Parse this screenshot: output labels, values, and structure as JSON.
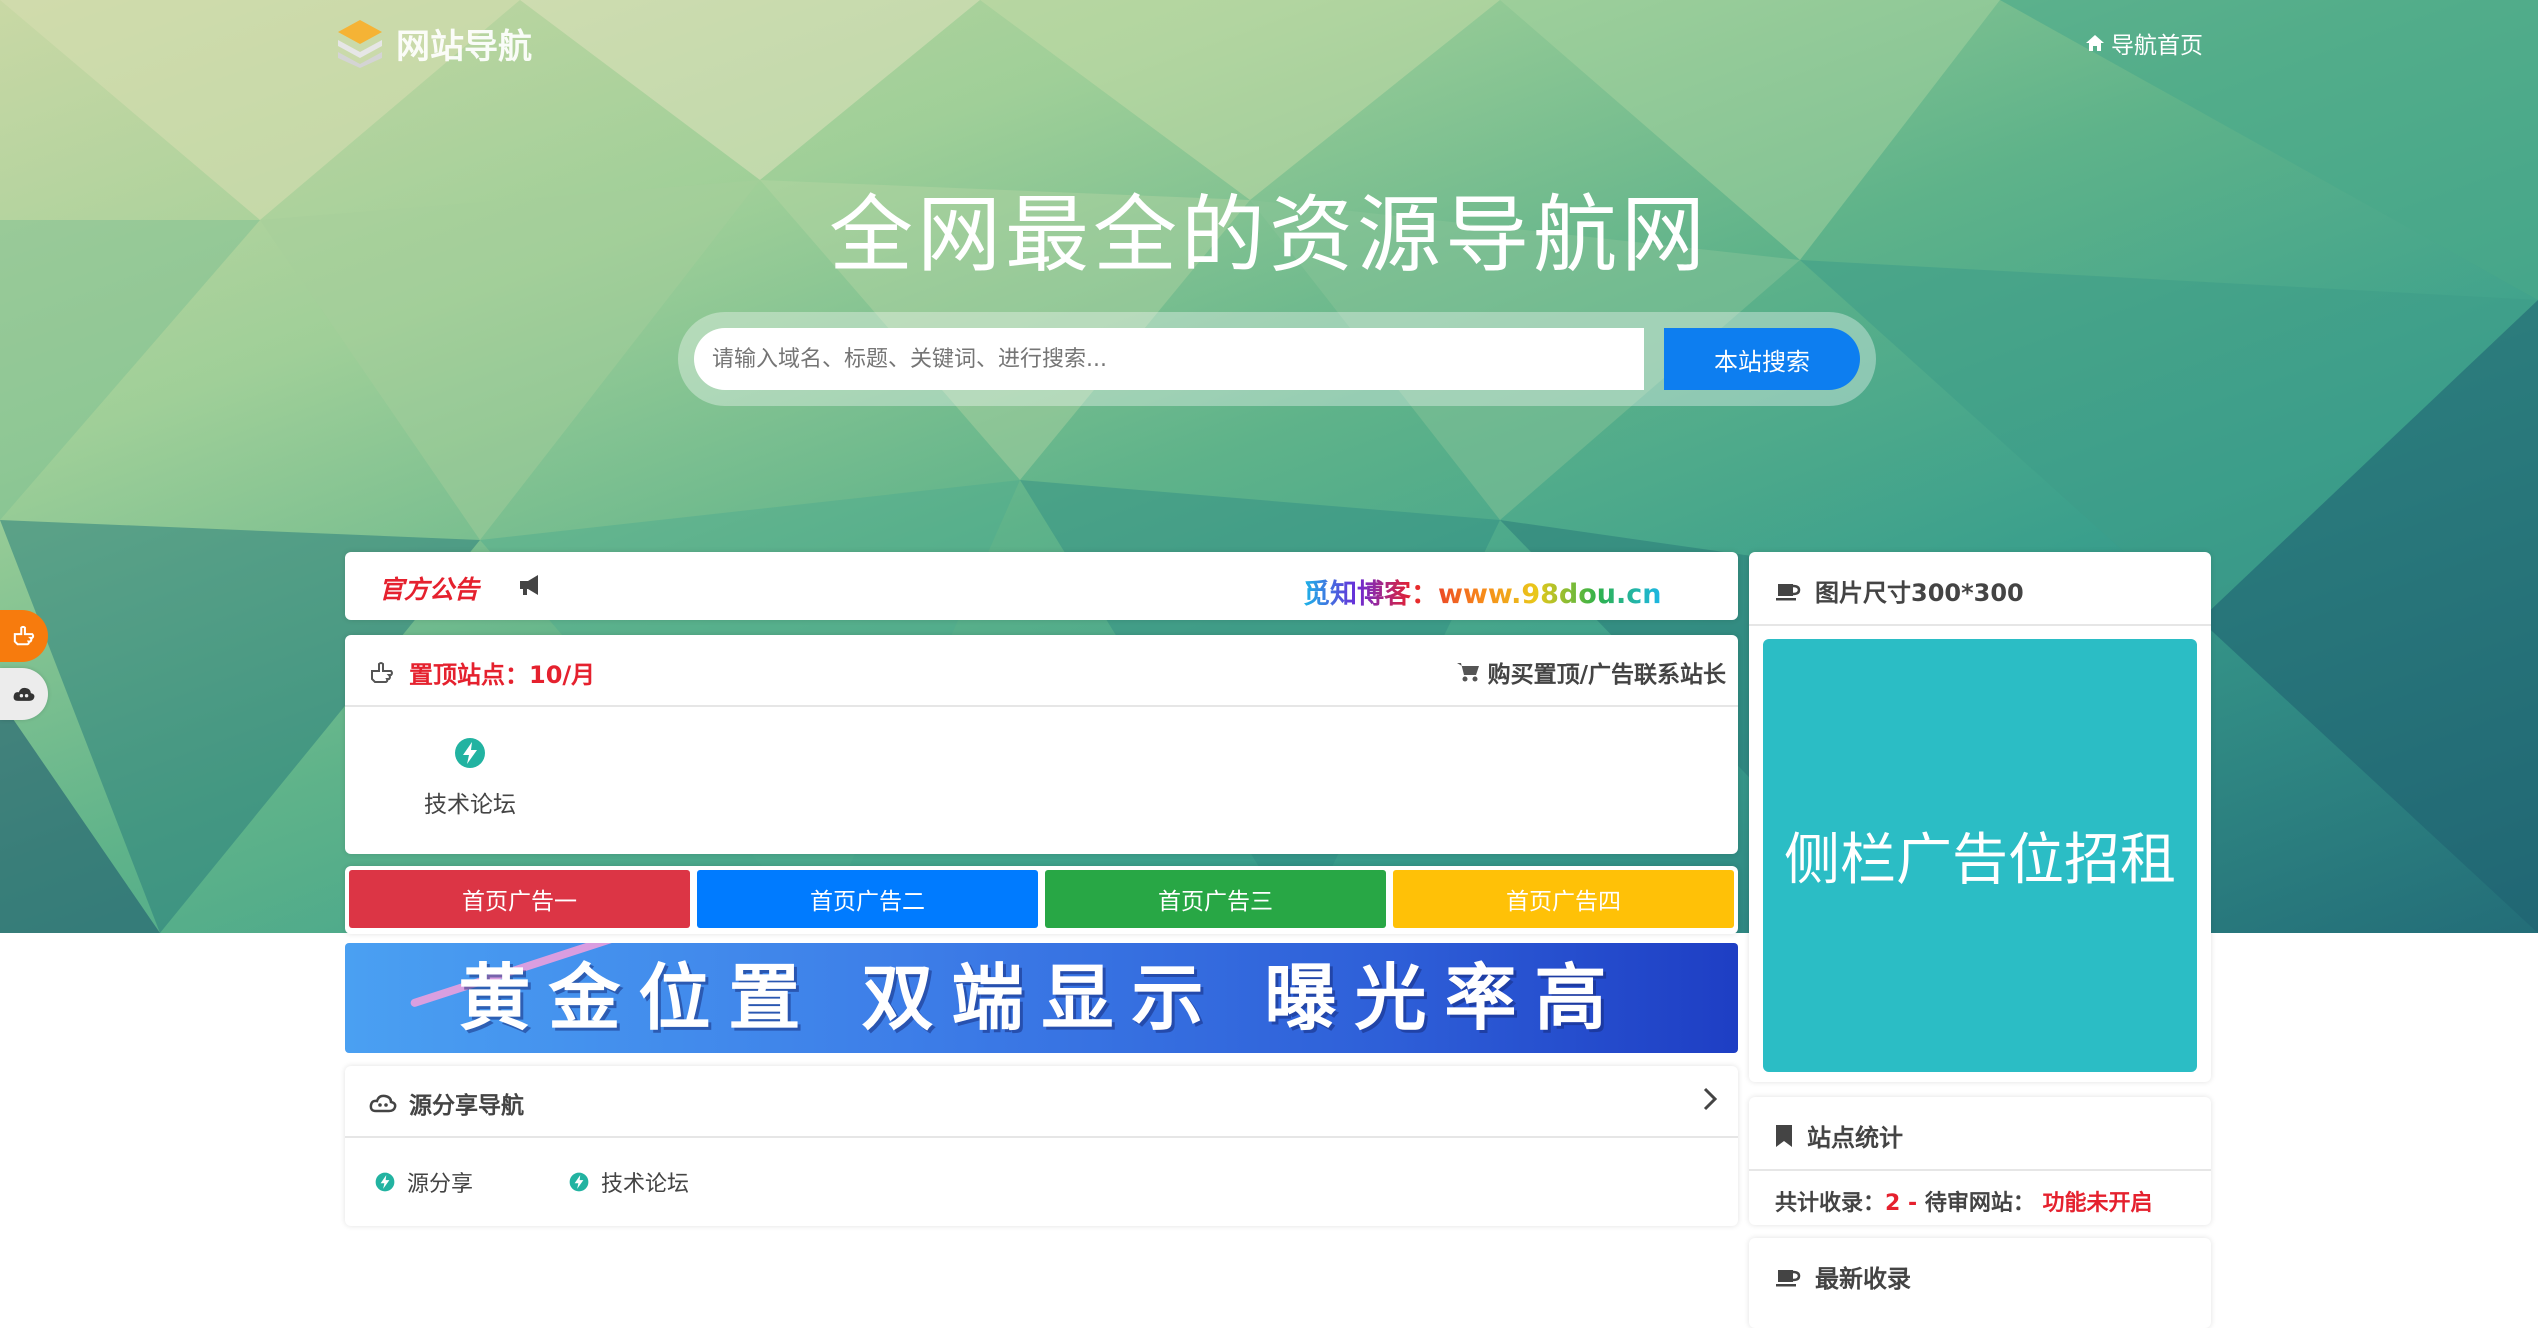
{
  "header": {
    "logo_text": "网站导航",
    "nav_home": "导航首页"
  },
  "hero": {
    "title": "全网最全的资源导航网"
  },
  "search": {
    "placeholder": "请输入域名、标题、关键词、进行搜索...",
    "button": "本站搜索"
  },
  "notice": {
    "label": "官方公告",
    "text": "觅知博客：www.98dou.cn"
  },
  "top_sites": {
    "title": "置顶站点：10/月",
    "buy_link": "购买置顶/广告联系站长",
    "sites": [
      {
        "name": "技术论坛"
      }
    ]
  },
  "ads": {
    "buttons": [
      {
        "label": "首页广告一",
        "color": "#dc3545"
      },
      {
        "label": "首页广告二",
        "color": "#007bff"
      },
      {
        "label": "首页广告三",
        "color": "#28a745"
      },
      {
        "label": "首页广告四",
        "color": "#ffc107"
      }
    ],
    "banner_text": "黄金位置 双端显示 曝光率高"
  },
  "source_nav": {
    "title": "源分享导航",
    "links": [
      {
        "name": "源分享"
      },
      {
        "name": "技术论坛"
      }
    ]
  },
  "sidebar": {
    "ad_title": "图片尺寸300*300",
    "ad_text": "侧栏广告位招租",
    "stats_title": "站点统计",
    "stats": {
      "total_label": "共计收录：",
      "total_value": "2",
      "sep": "-",
      "pending_label": "待审网站：",
      "pending_value": "功能未开启"
    },
    "latest_title": "最新收录"
  },
  "icons": {
    "logo": "layers-icon",
    "home": "home-icon",
    "megaphone": "bullhorn-icon",
    "hand": "hand-pointer-icon",
    "cart": "cart-icon",
    "bolt": "bolt-circle-icon",
    "cloud": "cloud-icon",
    "chevron": "chevron-right-icon",
    "coffee": "coffee-icon",
    "bookmark": "bookmark-icon"
  },
  "colors": {
    "accent": "#0d7ef0",
    "danger": "#e5212e",
    "teal": "#2bbdc5",
    "orange": "#f77b0d"
  }
}
